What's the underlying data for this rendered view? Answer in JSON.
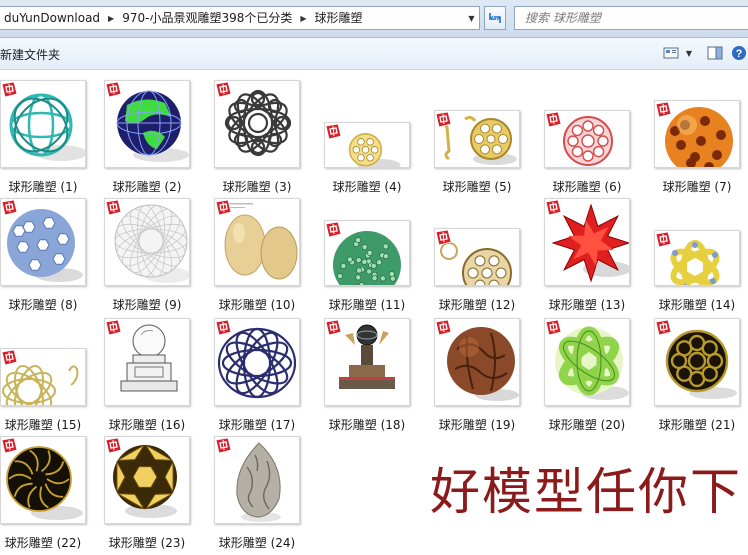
{
  "address": {
    "crumbs": [
      "duYunDownload",
      "970-小品景观雕塑398个已分类",
      "球形雕塑"
    ],
    "search_placeholder": "搜索 球形雕塑"
  },
  "toolbar": {
    "new_folder_label": "新建文件夹"
  },
  "items": [
    {
      "label": "球形雕塑 (1)",
      "kind": "teal-lattice-sphere",
      "color": "#2fb9b2"
    },
    {
      "label": "球形雕塑 (2)",
      "kind": "globe-cage",
      "color": "#2a2e8a"
    },
    {
      "label": "球形雕塑 (3)",
      "kind": "wire-knot",
      "color": "#3a3a3a"
    },
    {
      "label": "球形雕塑 (4)",
      "kind": "gold-lattice",
      "color": "#d4b24a"
    },
    {
      "label": "球形雕塑 (5)",
      "kind": "gold-lattice-frame",
      "color": "#d4b24a"
    },
    {
      "label": "球形雕塑 (6)",
      "kind": "red-lattice",
      "color": "#d84a4a"
    },
    {
      "label": "球形雕塑 (7)",
      "kind": "orange-pierced-sphere",
      "color": "#e8811f"
    },
    {
      "label": "球形雕塑 (8)",
      "kind": "blue-pierced-sphere",
      "color": "#8aa6d8"
    },
    {
      "label": "球形雕塑 (9)",
      "kind": "white-mesh-sphere",
      "color": "#d9d9d9"
    },
    {
      "label": "球形雕塑 (10)",
      "kind": "eggs",
      "color": "#e2c88e"
    },
    {
      "label": "球形雕塑 (11)",
      "kind": "green-mosaic-sphere",
      "color": "#3f9a6a"
    },
    {
      "label": "球形雕塑 (12)",
      "kind": "gold-ornament",
      "color": "#c9a65a"
    },
    {
      "label": "球形雕塑 (13)",
      "kind": "red-star",
      "color": "#e02020"
    },
    {
      "label": "球形雕塑 (14)",
      "kind": "yellow-knot",
      "color": "#e6d040"
    },
    {
      "label": "球形雕塑 (15)",
      "kind": "gold-wire-cage",
      "color": "#c8b45a"
    },
    {
      "label": "球形雕塑 (16)",
      "kind": "ball-on-pedestal",
      "color": "#e8e8e8"
    },
    {
      "label": "球形雕塑 (17)",
      "kind": "navy-rings",
      "color": "#2a2e6e"
    },
    {
      "label": "球形雕塑 (18)",
      "kind": "globe-monument",
      "color": "#6a5a4a"
    },
    {
      "label": "球形雕塑 (19)",
      "kind": "brown-carved-sphere",
      "color": "#8a4a2a"
    },
    {
      "label": "球形雕塑 (20)",
      "kind": "green-band-sphere",
      "color": "#8fd44a"
    },
    {
      "label": "球形雕塑 (21)",
      "kind": "dark-gold-filigree",
      "color": "#b89a2a"
    },
    {
      "label": "球形雕塑 (22)",
      "kind": "black-gold-filigree",
      "color": "#c9a030"
    },
    {
      "label": "球形雕塑 (23)",
      "kind": "gold-geometric",
      "color": "#d4b030"
    },
    {
      "label": "球形雕塑 (24)",
      "kind": "stone-carved-egg",
      "color": "#b5b0a5"
    }
  ],
  "watermark": "好模型任你下",
  "colors": {
    "accent": "#1d6fd0",
    "watermark": "#8c1a1a",
    "sketchup_badge": "#d8202a"
  }
}
